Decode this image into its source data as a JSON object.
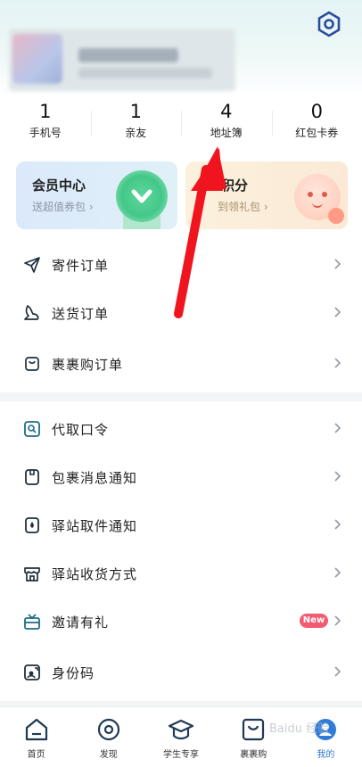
{
  "stats": [
    {
      "value": "1",
      "label": "手机号"
    },
    {
      "value": "1",
      "label": "亲友"
    },
    {
      "value": "4",
      "label": "地址簿"
    },
    {
      "value": "0",
      "label": "红包卡券"
    }
  ],
  "cards": {
    "member": {
      "title": "会员中心",
      "subtitle": "送超值券包"
    },
    "points": {
      "title": "积分",
      "subtitle": "到领礼包"
    }
  },
  "section1": [
    {
      "label": "寄件订单",
      "icon": "send-icon"
    },
    {
      "label": "送货订单",
      "icon": "delivery-icon"
    },
    {
      "label": "裹裹购订单",
      "icon": "bag-icon"
    }
  ],
  "section2": [
    {
      "label": "代取口令",
      "icon": "search-code-icon"
    },
    {
      "label": "包裹消息通知",
      "icon": "package-icon"
    },
    {
      "label": "驿站取件通知",
      "icon": "pickup-icon"
    },
    {
      "label": "驿站收货方式",
      "icon": "store-icon"
    },
    {
      "label": "邀请有礼",
      "icon": "tv-gift-icon",
      "badge": "New"
    },
    {
      "label": "身份码",
      "icon": "id-card-icon"
    }
  ],
  "tabs": [
    {
      "label": "首页",
      "icon": "home-icon"
    },
    {
      "label": "发现",
      "icon": "discover-icon"
    },
    {
      "label": "学生专享",
      "icon": "graduation-cap-icon"
    },
    {
      "label": "裹裹购",
      "icon": "shopping-bag-icon"
    },
    {
      "label": "我的",
      "icon": "profile-icon",
      "active": true
    }
  ],
  "watermark": "Baidu 经验",
  "colors": {
    "accent": "#2e7bd8",
    "icon": "#1f6b86",
    "arrow": "#f0141e",
    "badge": "#f25b72"
  }
}
